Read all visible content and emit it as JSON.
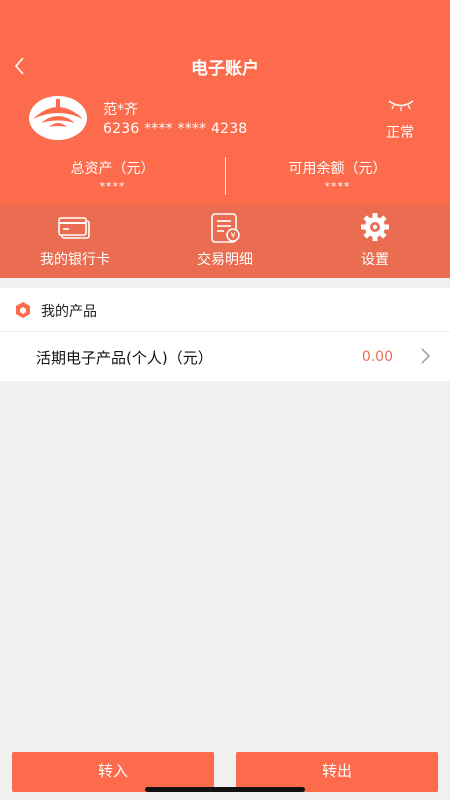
{
  "nav": {
    "title": "电子账户"
  },
  "account": {
    "name": "范*齐",
    "card_number": "6236 **** **** 4238",
    "status": "正常"
  },
  "stats": {
    "total_assets_label": "总资产（元）",
    "total_assets_value": "****",
    "available_label": "可用余额（元）",
    "available_value": "****"
  },
  "menu": {
    "items": [
      {
        "label": "我的银行卡",
        "icon": "bank-card-icon"
      },
      {
        "label": "交易明细",
        "icon": "transaction-detail-icon"
      },
      {
        "label": "设置",
        "icon": "gear-icon"
      }
    ]
  },
  "products": {
    "section_title": "我的产品",
    "rows": [
      {
        "name": "活期电子产品(个人)（元）",
        "value": "0.00"
      }
    ]
  },
  "actions": {
    "transfer_in": "转入",
    "transfer_out": "转出"
  },
  "colors": {
    "primary": "#fc6b4c",
    "menu_bg": "#ea6d52",
    "page_bg": "#f0f0f0"
  }
}
